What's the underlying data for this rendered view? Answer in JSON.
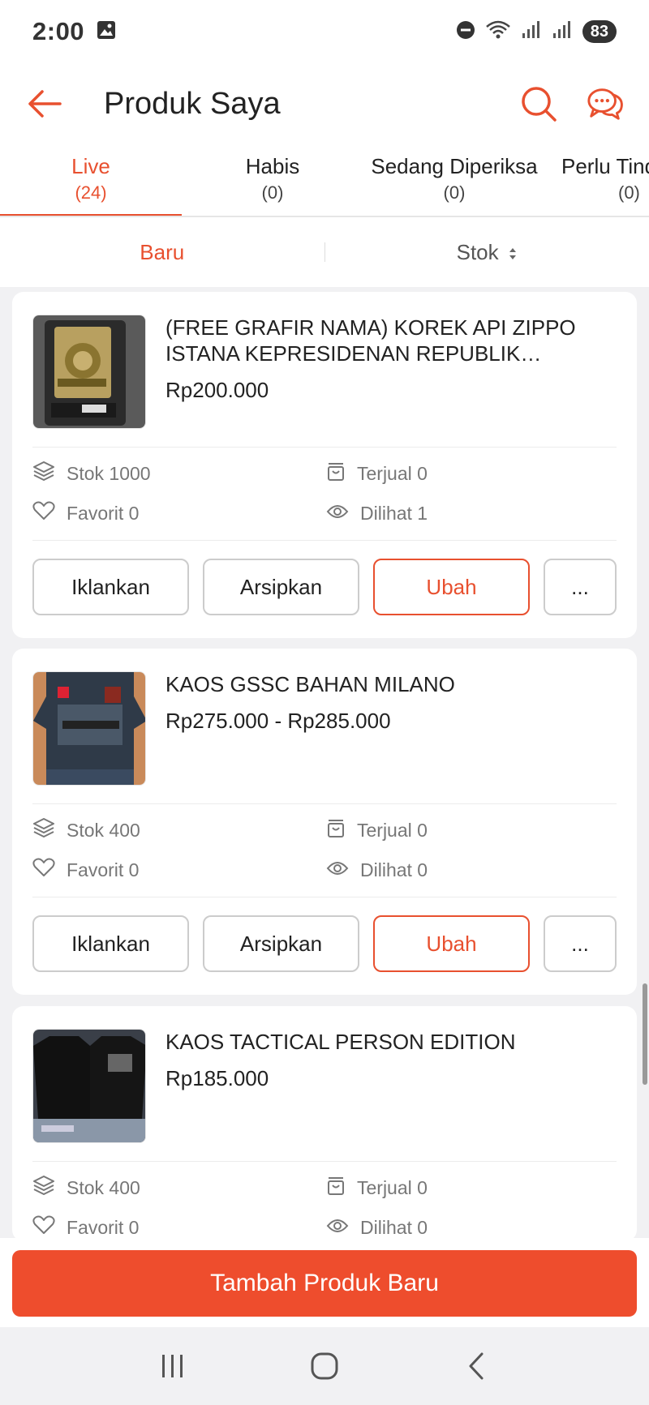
{
  "status_bar": {
    "time": "2:00",
    "battery": "83"
  },
  "header": {
    "title": "Produk Saya"
  },
  "tabs": [
    {
      "label": "Live",
      "count": "(24)"
    },
    {
      "label": "Habis",
      "count": "(0)"
    },
    {
      "label": "Sedang Diperiksa",
      "count": "(0)"
    },
    {
      "label": "Perlu Tindakan",
      "count": "(0)"
    }
  ],
  "sort": {
    "new_label": "Baru",
    "stock_label": "Stok"
  },
  "products": [
    {
      "name": "(FREE GRAFIR NAMA) KOREK API ZIPPO ISTANA KEPRESIDENAN REPUBLIK INDONESIA",
      "price": "Rp200.000",
      "stock": "Stok 1000",
      "sold": "Terjual 0",
      "favorite": "Favorit 0",
      "views": "Dilihat 1"
    },
    {
      "name": "KAOS GSSC BAHAN MILANO",
      "price": "Rp275.000 - Rp285.000",
      "stock": "Stok 400",
      "sold": "Terjual 0",
      "favorite": "Favorit 0",
      "views": "Dilihat 0"
    },
    {
      "name": "KAOS TACTICAL PERSON EDITION",
      "price": "Rp185.000",
      "stock": "Stok 400",
      "sold": "Terjual 0",
      "favorite": "Favorit 0",
      "views": "Dilihat 0"
    }
  ],
  "actions": {
    "promote": "Iklankan",
    "archive": "Arsipkan",
    "edit": "Ubah",
    "more": "..."
  },
  "bottom": {
    "add_product": "Tambah Produk Baru"
  },
  "colors": {
    "accent": "#ee4d2d"
  }
}
